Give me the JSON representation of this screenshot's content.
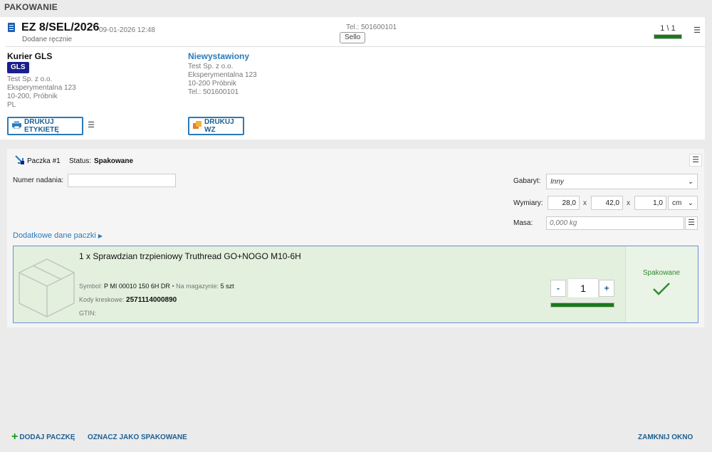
{
  "page": {
    "title": "PAKOWANIE"
  },
  "document": {
    "number": "EZ 8/SEL/2026",
    "date": "09-01-2026 12:48",
    "source": "Dodane ręcznie",
    "phone": "Tel.: 501600101",
    "channel_badge": "Sello",
    "counter": "1 \\ 1",
    "counter_progress": 1.0
  },
  "carrier": {
    "title": "Kurier GLS",
    "badge": "GLS",
    "address": [
      "Test Sp. z o.o.",
      "Eksperymentalna 123",
      "10-200, Próbnik",
      "PL"
    ],
    "print_label_button": "DRUKUJ ETYKIETĘ"
  },
  "recipient": {
    "status": "Niewystawiony",
    "address": [
      "Test Sp. z o.o.",
      "Eksperymentalna 123",
      "10-200 Próbnik",
      "Tel.:  501600101"
    ],
    "print_wz_button": "DRUKUJ WZ"
  },
  "package": {
    "name": "Paczka #1",
    "status_label": "Status:",
    "status_value": "Spakowane",
    "tracking_label": "Numer nadania:",
    "tracking_value": "",
    "size_label": "Gabaryt:",
    "size_value": "Inny",
    "dims_label": "Wymiary:",
    "dim1": "28,0",
    "dim2": "42,0",
    "dim3": "1,0",
    "dim_sep": "x",
    "dim_unit": "cm",
    "mass_label": "Masa:",
    "mass_placeholder": "0,000 kg",
    "extra_link": "Dodatkowe dane paczki"
  },
  "item": {
    "title": "1 x Sprawdzian trzpieniowy Truthread GO+NOGO M10-6H",
    "symbol_label": "Symbol:",
    "symbol_value": "P MI 00010 150 6H DR",
    "stock_label": "Na magazynie:",
    "stock_value": "5 szt",
    "barcode_label": "Kody kreskowe:",
    "barcode_value": "2571114000890",
    "gtin_label": "GTIN:",
    "quantity": "1",
    "minus": "-",
    "plus": "+",
    "packed_label": "Spakowane",
    "packed_progress": 1.0
  },
  "footer": {
    "add_package": "DODAJ PACZKĘ",
    "mark_packed": "OZNACZ JAKO SPAKOWANE",
    "close": "ZAMKNIJ OKNO"
  },
  "colors": {
    "accent": "#2a7ab8",
    "success": "#1a7a1a",
    "carrier_badge": "#1b1f8c"
  }
}
